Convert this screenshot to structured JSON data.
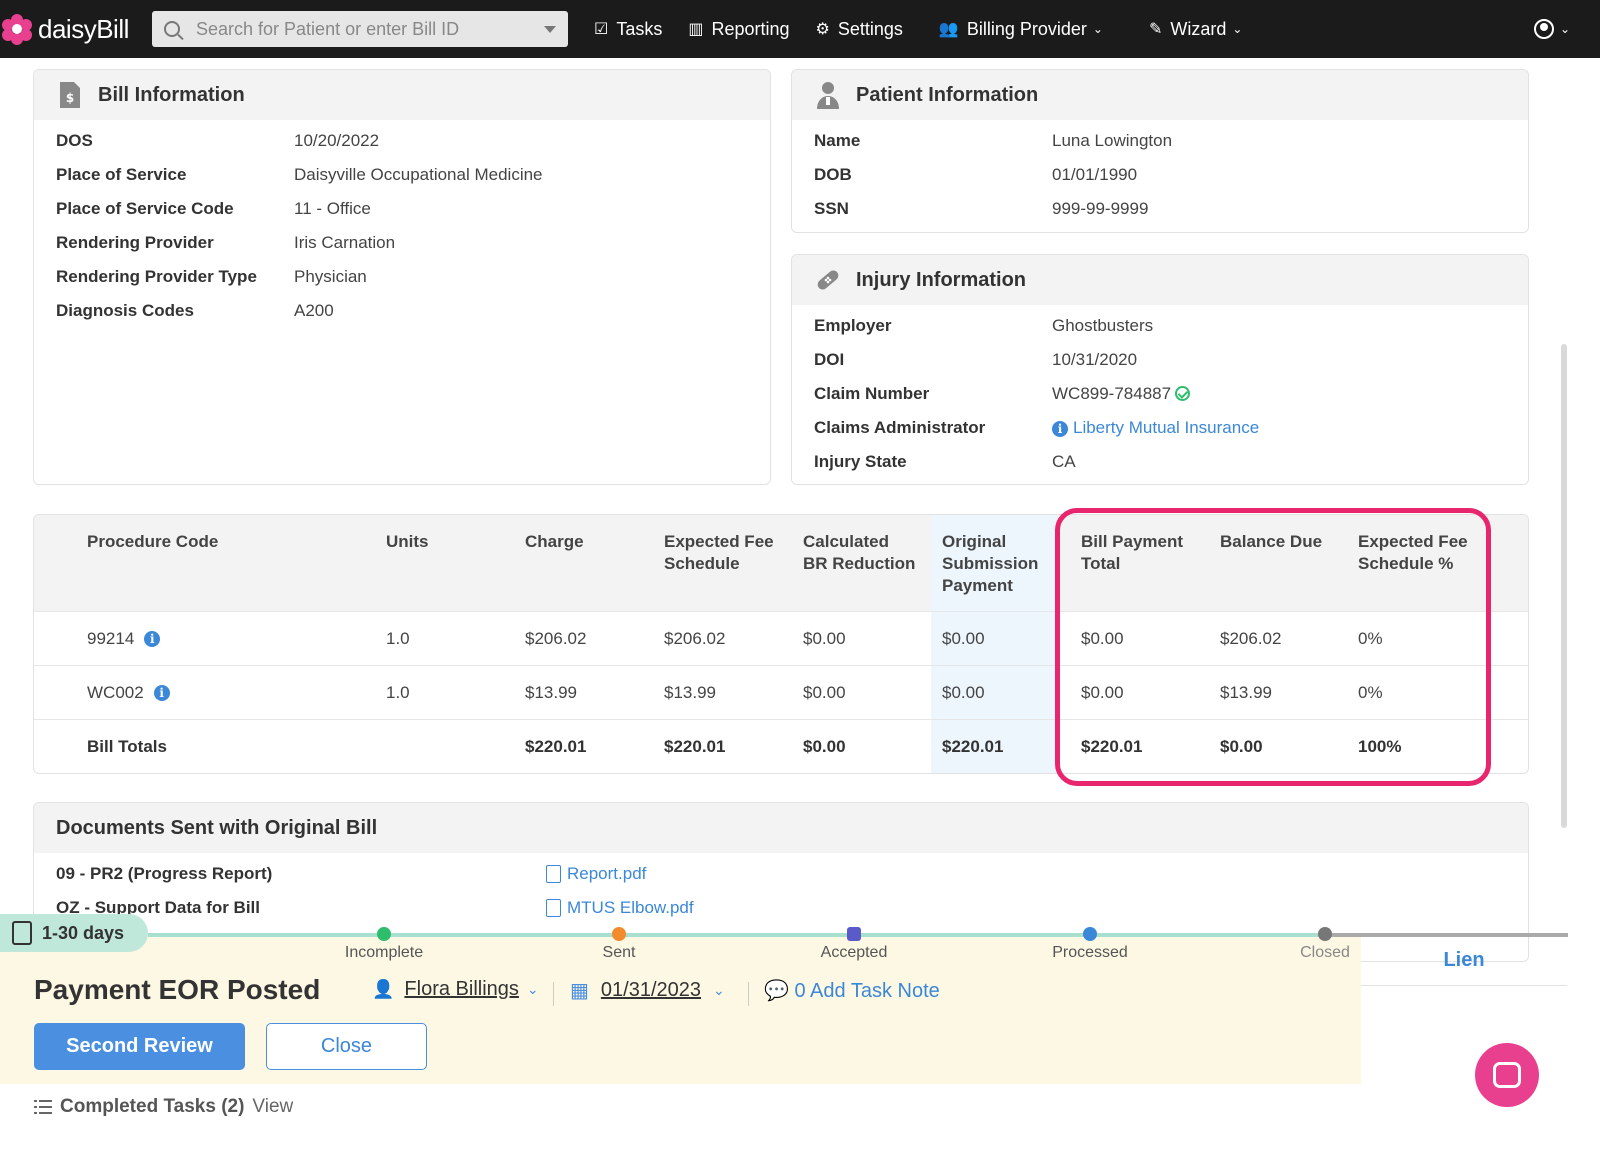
{
  "nav": {
    "logo": "daisyBill",
    "search_placeholder": "Search for Patient or enter Bill ID",
    "items": [
      {
        "label": "Tasks",
        "icon": "clipboard-check-icon"
      },
      {
        "label": "Reporting",
        "icon": "bar-chart-icon"
      },
      {
        "label": "Settings",
        "icon": "gear-icon"
      },
      {
        "label": "Billing Provider",
        "icon": "users-icon"
      },
      {
        "label": "Wizard",
        "icon": "magic-wand-icon"
      }
    ]
  },
  "bill_info": {
    "title": "Bill Information",
    "rows": [
      {
        "label": "DOS",
        "value": "10/20/2022"
      },
      {
        "label": "Place of Service",
        "value": "Daisyville Occupational Medicine"
      },
      {
        "label": "Place of Service Code",
        "value": "11 - Office"
      },
      {
        "label": "Rendering Provider",
        "value": "Iris Carnation"
      },
      {
        "label": "Rendering Provider Type",
        "value": "Physician"
      },
      {
        "label": "Diagnosis Codes",
        "value": "A200"
      }
    ]
  },
  "patient_info": {
    "title": "Patient Information",
    "rows": [
      {
        "label": "Name",
        "value": "Luna Lowington"
      },
      {
        "label": "DOB",
        "value": "01/01/1990"
      },
      {
        "label": "SSN",
        "value": "999-99-9999"
      }
    ]
  },
  "injury_info": {
    "title": "Injury Information",
    "rows": [
      {
        "label": "Employer",
        "value": "Ghostbusters"
      },
      {
        "label": "DOI",
        "value": "10/31/2020"
      },
      {
        "label": "Claim Number",
        "value": "WC899-784887"
      },
      {
        "label": "Claims Administrator",
        "value": "Liberty Mutual Insurance"
      },
      {
        "label": "Injury State",
        "value": "CA"
      }
    ]
  },
  "procedures": {
    "headers": {
      "code": "Procedure Code",
      "units": "Units",
      "charge": "Charge",
      "efs_1": "Expected Fee",
      "efs_2": "Schedule",
      "cbr_1": "Calculated",
      "cbr_2": "BR Reduction",
      "osp_1": "Original",
      "osp_2": "Submission",
      "osp_3": "Payment",
      "bpt_1": "Bill Payment",
      "bpt_2": "Total",
      "bal": "Balance Due",
      "efsp_1": "Expected Fee",
      "efsp_2": "Schedule %"
    },
    "rows": [
      {
        "code": "99214",
        "units": "1.0",
        "charge": "$206.02",
        "efs": "$206.02",
        "cbr": "$0.00",
        "osp": "$0.00",
        "bpt": "$0.00",
        "bal": "$206.02",
        "efsp": "0%"
      },
      {
        "code": "WC002",
        "units": "1.0",
        "charge": "$13.99",
        "efs": "$13.99",
        "cbr": "$0.00",
        "osp": "$0.00",
        "bpt": "$0.00",
        "bal": "$13.99",
        "efsp": "0%"
      }
    ],
    "totals": {
      "label": "Bill Totals",
      "charge": "$220.01",
      "efs": "$220.01",
      "cbr": "$0.00",
      "osp": "$220.01",
      "bpt": "$220.01",
      "bal": "$0.00",
      "efsp": "100%"
    }
  },
  "documents": {
    "title": "Documents Sent with Original Bill",
    "rows": [
      {
        "label": "09 - PR2 (Progress Report)",
        "file": "Report.pdf"
      },
      {
        "label": "OZ - Support Data for Bill",
        "file": "MTUS Elbow.pdf"
      }
    ]
  },
  "task": {
    "age": "1-30 days",
    "stages": [
      "Incomplete",
      "Sent",
      "Accepted",
      "Processed",
      "Closed"
    ],
    "title": "Payment EOR Posted",
    "assignee": "Flora Billings",
    "date": "01/31/2023",
    "note": "0 Add Task Note",
    "primary_button": "Second Review",
    "secondary_button": "Close",
    "side_tab": "Lien",
    "completed_label": "Completed Tasks (2)",
    "completed_link": "View"
  },
  "colors": {
    "accent": "#3b87d8",
    "highlight": "#e8266d",
    "brand": "#e8408e"
  }
}
